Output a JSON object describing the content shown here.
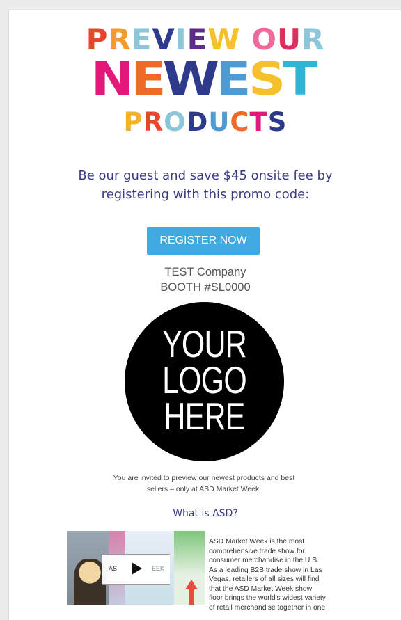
{
  "headline": {
    "line1": [
      {
        "t": "P",
        "c": "#e8452c"
      },
      {
        "t": "R",
        "c": "#f39c2e"
      },
      {
        "t": "E",
        "c": "#8bc6d9"
      },
      {
        "t": "V",
        "c": "#2e3a8c"
      },
      {
        "t": "I",
        "c": "#8bc6d9"
      },
      {
        "t": "E",
        "c": "#5e2e86"
      },
      {
        "t": "W",
        "c": "#f4c02b"
      },
      {
        "t": " ",
        "c": "#ffffff"
      },
      {
        "t": "O",
        "c": "#ef6a9a"
      },
      {
        "t": "U",
        "c": "#d6315f"
      },
      {
        "t": "R",
        "c": "#8bc6d9"
      }
    ],
    "line2": [
      {
        "t": "N",
        "c": "#e4187a"
      },
      {
        "t": "E",
        "c": "#ef6a27"
      },
      {
        "t": "W",
        "c": "#2e3a8c"
      },
      {
        "t": "E",
        "c": "#4e9ad2"
      },
      {
        "t": "S",
        "c": "#f4c02b"
      },
      {
        "t": "T",
        "c": "#2fb6d6"
      }
    ],
    "line3": [
      {
        "t": "P",
        "c": "#f4b02b"
      },
      {
        "t": "R",
        "c": "#e8452c"
      },
      {
        "t": "O",
        "c": "#8bc6d9"
      },
      {
        "t": "D",
        "c": "#2e3a8c"
      },
      {
        "t": "U",
        "c": "#4e9ad2"
      },
      {
        "t": "C",
        "c": "#ef6a27"
      },
      {
        "t": "T",
        "c": "#e4187a"
      },
      {
        "t": "S",
        "c": "#2e3a8c"
      }
    ]
  },
  "promo": {
    "line1": "Be our guest and save $45 onsite fee by",
    "line2": "registering with this promo code:"
  },
  "cta": {
    "label": "REGISTER NOW"
  },
  "company": {
    "name": "TEST Company",
    "booth": "BOOTH #SL0000"
  },
  "logo": {
    "lines": [
      "YOUR",
      "LOGO",
      "HERE"
    ]
  },
  "invite": {
    "line1": "You are invited to preview our newest products and best",
    "line2": "sellers – only at ASD Market Week."
  },
  "what": {
    "title": "What is ASD?"
  },
  "video": {
    "left_text": "AS",
    "right_text": "EEK"
  },
  "about": {
    "lines": [
      "ASD Market Week is the most",
      "comprehensive trade show for",
      "consumer merchandise in the U.S.",
      "As a leading B2B trade show in Las",
      "Vegas, retailers of all sizes will find",
      "that the ASD Market Week show",
      "floor brings the world's widest variety",
      "of retail merchandise together in one"
    ]
  },
  "colors": {
    "accent_blue": "#3fa9e0",
    "navy_text": "#3a3d84"
  }
}
